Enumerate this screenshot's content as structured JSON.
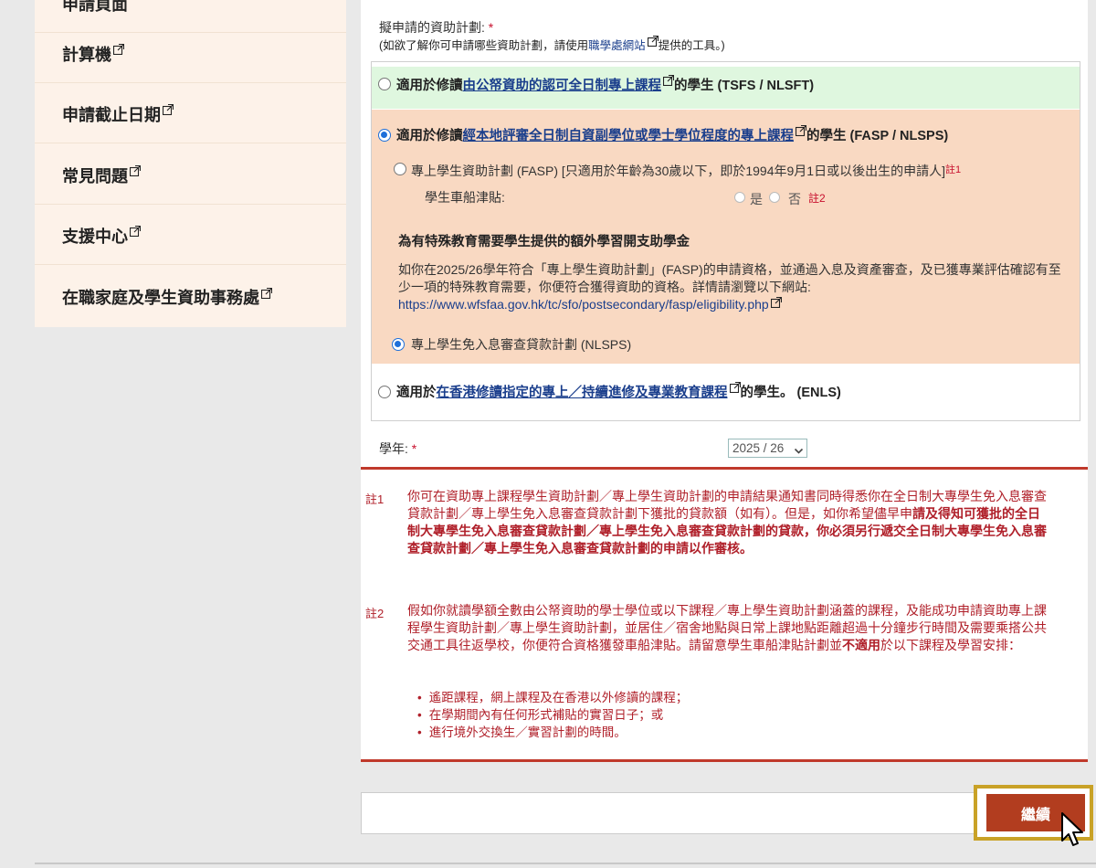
{
  "sidebar": {
    "top_partial": "申請頁面",
    "items": [
      {
        "label": "計算機"
      },
      {
        "label": "申請截止日期"
      },
      {
        "label": "常見問題"
      },
      {
        "label": "支援中心"
      },
      {
        "label": "在職家庭及學生資助事務處"
      }
    ]
  },
  "form": {
    "plan_label": "擬申請的資助計劃:",
    "required_mark": "*",
    "hint_prefix": "(如欲了解你可申請哪些資助計劃，請使用",
    "hint_link": "職學處網站",
    "hint_suffix": "提供的工具。)",
    "option1": {
      "prefix": "適用於修讀",
      "link": "由公帑資助的認可全日制專上課程",
      "suffix": "的學生 (TSFS / NLSFT)"
    },
    "option2": {
      "prefix": "適用於修讀",
      "link": "經本地評審全日制自資副學位或學士學位程度的專上課程",
      "suffix": "的學生 (FASP / NLSPS)",
      "fasp_label": "專上學生資助計劃 (FASP)  [只適用於年齡為30歲以下，即於1994年9月1日或以後出生的申請人]",
      "fasp_note": "註1",
      "travel_label": "學生車船津貼:",
      "yes": "是",
      "no": "否",
      "travel_note": "註2",
      "ssn_title": "為有特殊教育需要學生提供的額外學習開支助學金",
      "ssn_body": "如你在2025/26學年符合「專上學生資助計劃」(FASP)的申請資格，並通過入息及資產審查，及已獲專業評估確認有至少一項的特殊教育需要，你便符合獲得資助的資格。詳情請瀏覽以下網站:",
      "ssn_link": "https://www.wfsfaa.gov.hk/tc/sfo/postsecondary/fasp/eligibility.php",
      "nlsps_label": "專上學生免入息審查貸款計劃 (NLSPS)"
    },
    "option3": {
      "prefix": "適用於",
      "link": "在香港修讀指定的專上／持續進修及專業教育課程",
      "suffix": "的學生。 (ENLS)"
    },
    "year_label": "學年:",
    "year_value": "2025 / 26"
  },
  "notes": {
    "note1_tag": "註1",
    "note1_plain": "你可在資助專上課程學生資助計劃／專上學生資助計劃的申請結果通知書同時得悉你在全日制大專學生免入息審查貸款計劃／專上學生免入息審查貸款計劃下獲批的貸款額（如有）。但是，如你希望儘早申",
    "note1_bold": "請及得知可獲批的全日制大專學生免入息審查貸款計劃／專上學生免入息審查貸款計劃的貸款，你必須另行遞交全日制大專學生免入息審查貸款計劃／專上學生免入息審查貸款計劃的申請以作審核。",
    "note2_tag": "註2",
    "note2_plain": "假如你就讀學額全數由公帑資助的學士學位或以下課程／專上學生資助計劃涵蓋的課程，及能成功申請資助專上課程學生資助計劃／專上學生資助計劃，並居住／宿舍地點與日常上課地點距離超過十分鐘步行時間及需要乘搭公共交通工具往返學校，你便符合資格獲發車船津貼。請留意學生車船津貼計劃並",
    "note2_bold": "不適用",
    "note2_tail": "於以下課程及學習安排：",
    "bullets": [
      "遙距課程，網上課程及在香港以外修讀的課程；",
      "在學期間內有任何形式補貼的實習日子；或",
      "進行境外交換生／實習計劃的時間。"
    ]
  },
  "actions": {
    "continue_label": "繼續"
  },
  "colors": {
    "accent_red": "#b23d1f",
    "highlight_gold": "#c9a227",
    "green_row": "#dff7df",
    "peach_row": "#f9d9c2",
    "note_red": "#b0202a"
  }
}
